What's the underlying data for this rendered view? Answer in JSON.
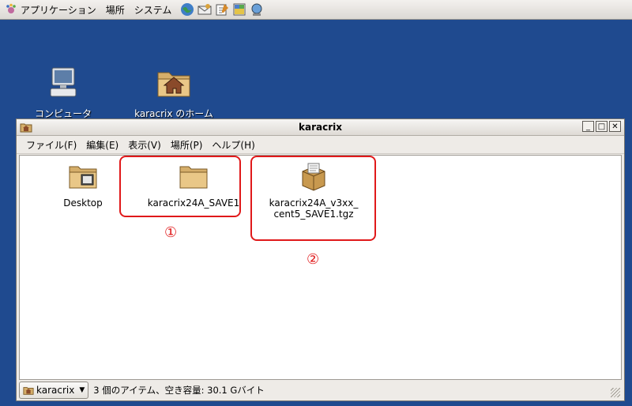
{
  "panel": {
    "menus": [
      "アプリケーション",
      "場所",
      "システム"
    ],
    "launchers": [
      "web-browser-icon",
      "email-icon",
      "text-editor-icon",
      "notes-icon",
      "network-icon"
    ]
  },
  "desktop": {
    "icons": [
      {
        "label": "コンピュータ",
        "icon": "computer-icon"
      },
      {
        "label": "karacrix のホーム",
        "icon": "home-folder-icon"
      }
    ]
  },
  "window": {
    "title": "karacrix",
    "menu": [
      "ファイル(F)",
      "編集(E)",
      "表示(V)",
      "場所(P)",
      "ヘルプ(H)"
    ],
    "files": [
      {
        "name": "Desktop",
        "icon": "desktop-folder-icon"
      },
      {
        "name": "karacrix24A_SAVE1",
        "icon": "folder-icon"
      },
      {
        "name": "karacrix24A_v3xx_",
        "name2": "cent5_SAVE1.tgz",
        "icon": "archive-icon"
      }
    ],
    "callouts": [
      "①",
      "②"
    ],
    "status": {
      "location": "karacrix",
      "text": "3 個のアイテム、空き容量: 30.1 Gバイト"
    }
  },
  "colors": {
    "desktop": "#1f4a8f",
    "highlight": "#e0191a"
  }
}
